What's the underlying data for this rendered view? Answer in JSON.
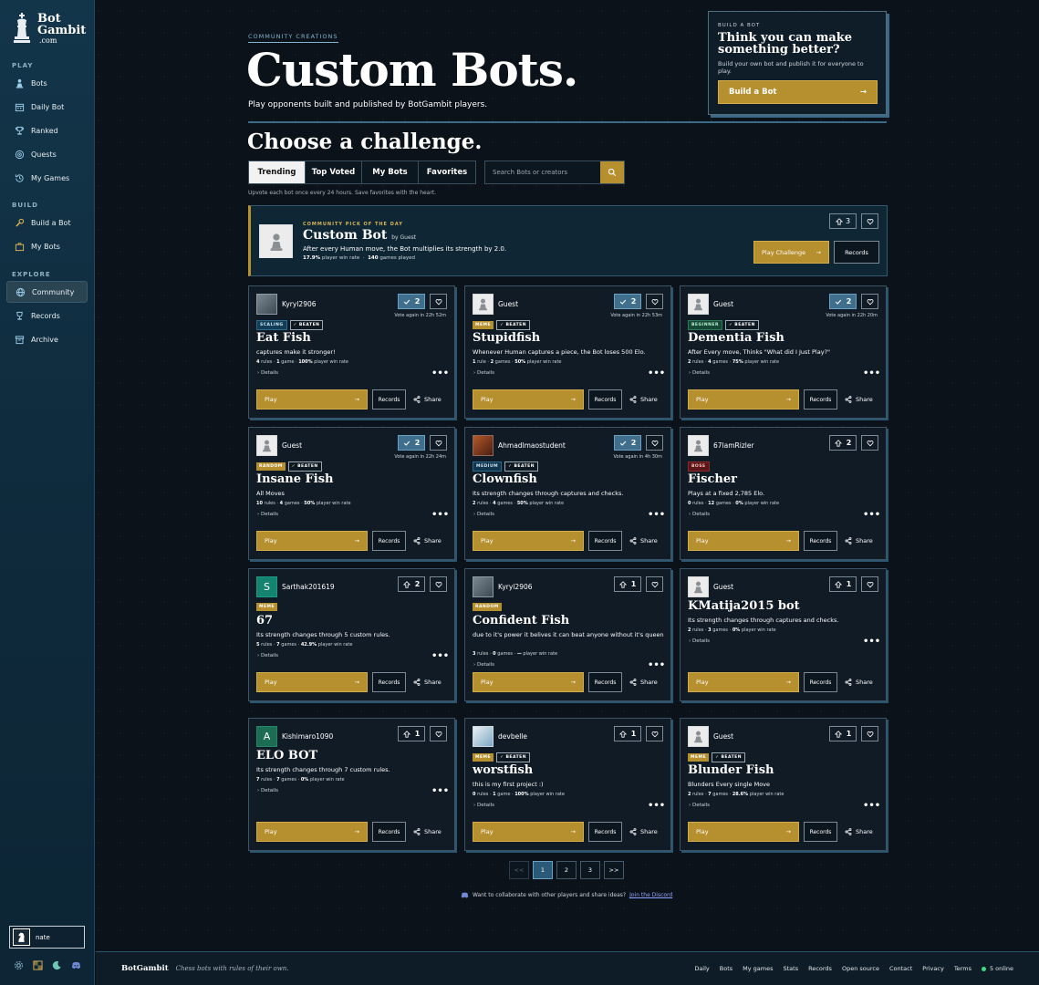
{
  "brand": {
    "line1": "Bot",
    "line2": "Gambit",
    "line3": ".com"
  },
  "sidebar": {
    "sections": [
      {
        "label": "PLAY",
        "items": [
          {
            "label": "Bots",
            "icon": "pawn-icon"
          },
          {
            "label": "Daily Bot",
            "icon": "calendar-icon"
          },
          {
            "label": "Ranked",
            "icon": "trophy-icon"
          },
          {
            "label": "Quests",
            "icon": "target-icon"
          },
          {
            "label": "My Games",
            "icon": "history-icon"
          }
        ]
      },
      {
        "label": "BUILD",
        "items": [
          {
            "label": "Build a Bot",
            "icon": "wrench-icon"
          },
          {
            "label": "My Bots",
            "icon": "briefcase-icon"
          }
        ]
      },
      {
        "label": "EXPLORE",
        "items": [
          {
            "label": "Community",
            "icon": "globe-icon"
          },
          {
            "label": "Records",
            "icon": "trophy-icon"
          },
          {
            "label": "Archive",
            "icon": "archive-icon"
          }
        ]
      }
    ],
    "user": {
      "name": "nate"
    }
  },
  "hero": {
    "eyebrow": "COMMUNITY CREATIONS",
    "title": "Custom Bots.",
    "subtitle": "Play opponents built and published by BotGambit players."
  },
  "build_card": {
    "eyebrow": "BUILD A BOT",
    "title": "Think you can make something better?",
    "text": "Build your own bot and publish it for everyone to play.",
    "button": "Build a Bot",
    "arrow": "→"
  },
  "challenge": {
    "title": "Choose a challenge.",
    "tabs": [
      "Trending",
      "Top Voted",
      "My Bots",
      "Favorites"
    ],
    "active_tab": "Trending",
    "search_placeholder": "Search Bots or creators",
    "hint": "Upvote each bot once every 24 hours. Save favorites with the heart."
  },
  "featured": {
    "eyebrow": "COMMUNITY PICK OF THE DAY",
    "name": "Custom Bot",
    "by": "by Guest",
    "desc": "After every Human move, the Bot multiplies its strength by 2.0.",
    "win_rate": "17.9%",
    "win_label": "player win rate",
    "games": "140",
    "games_label": "games played",
    "votes": "3",
    "play_label": "Play Challenge",
    "records_label": "Records",
    "arrow": "→"
  },
  "labels": {
    "play": "Play",
    "records": "Records",
    "share": "Share",
    "details": "Details",
    "rules": "rules",
    "games": "games",
    "game": "game",
    "rule": "rule",
    "win": "player win rate",
    "more": "•••",
    "arrow": "→",
    "beaten": "BEATEN"
  },
  "bots": [
    {
      "creator": "Kyryl2906",
      "avatar": "photo",
      "votes": "2",
      "voted": true,
      "again": "Vote again in 22h 52m",
      "tags": [
        "SCALING"
      ],
      "tagclass": [
        "scaling"
      ],
      "beaten": true,
      "title": "Eat Fish",
      "desc": "captures make it stronger!",
      "rules": "4",
      "rules_label": "rules",
      "games": "1",
      "games_label": "game",
      "win": "100%"
    },
    {
      "creator": "Guest",
      "avatar": "guest",
      "votes": "2",
      "voted": true,
      "again": "Vote again in 22h 53m",
      "tags": [
        "MEME"
      ],
      "tagclass": [
        "meme"
      ],
      "beaten": true,
      "title": "Stupidfish",
      "desc": "Whenever Human captures a piece, the Bot loses 500 Elo.",
      "rules": "1",
      "rules_label": "rule",
      "games": "2",
      "games_label": "games",
      "win": "50%"
    },
    {
      "creator": "Guest",
      "avatar": "guest",
      "votes": "2",
      "voted": true,
      "again": "Vote again in 22h 20m",
      "tags": [
        "BEGINNER"
      ],
      "tagclass": [
        "beginner"
      ],
      "beaten": true,
      "title": "Dementia Fish",
      "desc": "After Every move, Thinks \"What did I Just Play?\"",
      "rules": "2",
      "rules_label": "rules",
      "games": "4",
      "games_label": "games",
      "win": "75%"
    },
    {
      "creator": "Guest",
      "avatar": "guest",
      "votes": "2",
      "voted": true,
      "again": "Vote again in 22h 24m",
      "tags": [
        "RANDOM"
      ],
      "tagclass": [
        "random"
      ],
      "beaten": true,
      "title": "Insane Fish",
      "desc": "All Moves",
      "rules": "10",
      "rules_label": "rules",
      "games": "4",
      "games_label": "games",
      "win": "50%"
    },
    {
      "creator": "Ahmadlmaostudent",
      "avatar": "photo2",
      "votes": "2",
      "voted": true,
      "again": "Vote again in 4h 30m",
      "tags": [
        "MEDIUM"
      ],
      "tagclass": [
        "medium"
      ],
      "beaten": true,
      "title": "Clownfish",
      "desc": "Its strength changes through captures and checks.",
      "rules": "2",
      "rules_label": "rules",
      "games": "4",
      "games_label": "games",
      "win": "50%"
    },
    {
      "creator": "67lamRizler",
      "avatar": "guest",
      "votes": "2",
      "voted": false,
      "again": "",
      "tags": [
        "BOSS"
      ],
      "tagclass": [
        "boss"
      ],
      "beaten": false,
      "title": "Fischer",
      "desc": "Plays at a fixed 2,785 Elo.",
      "rules": "0",
      "rules_label": "rules",
      "games": "12",
      "games_label": "games",
      "win": "0%"
    },
    {
      "creator": "Sarthak201619",
      "avatar": "teal",
      "initial": "S",
      "votes": "2",
      "voted": false,
      "again": "",
      "tags": [
        "MEME"
      ],
      "tagclass": [
        "meme"
      ],
      "beaten": false,
      "title": "67",
      "desc": "Its strength changes through 5 custom rules.",
      "rules": "5",
      "rules_label": "rules",
      "games": "7",
      "games_label": "games",
      "win": "42.9%"
    },
    {
      "creator": "Kyryl2906",
      "avatar": "photo",
      "votes": "1",
      "voted": false,
      "again": "",
      "tags": [
        "RANDOM"
      ],
      "tagclass": [
        "random"
      ],
      "beaten": false,
      "title": "Confident Fish",
      "desc": "due to it's power it belives it can beat anyone without it's queen",
      "rules": "3",
      "rules_label": "rules",
      "games": "0",
      "games_label": "games",
      "win": "—"
    },
    {
      "creator": "Guest",
      "avatar": "guest",
      "votes": "1",
      "voted": false,
      "again": "",
      "tags": [],
      "tagclass": [],
      "beaten": false,
      "title": "KMatija2015 bot",
      "desc": "Its strength changes through captures and checks.",
      "rules": "2",
      "rules_label": "rules",
      "games": "3",
      "games_label": "games",
      "win": "0%"
    },
    {
      "creator": "Kishimaro1090",
      "avatar": "green",
      "initial": "A",
      "votes": "1",
      "voted": false,
      "again": "",
      "tags": [],
      "tagclass": [],
      "beaten": false,
      "title": "ELO BOT",
      "desc": "Its strength changes through 7 custom rules.",
      "rules": "7",
      "rules_label": "rules",
      "games": "7",
      "games_label": "games",
      "win": "0%"
    },
    {
      "creator": "devbelle",
      "avatar": "photo3",
      "votes": "1",
      "voted": false,
      "again": "",
      "tags": [
        "MEME"
      ],
      "tagclass": [
        "meme"
      ],
      "beaten": true,
      "title": "worstfish",
      "desc": "this is my first project :)",
      "rules": "0",
      "rules_label": "rules",
      "games": "1",
      "games_label": "game",
      "win": "100%"
    },
    {
      "creator": "Guest",
      "avatar": "guest",
      "votes": "1",
      "voted": false,
      "again": "",
      "tags": [
        "MEME"
      ],
      "tagclass": [
        "meme"
      ],
      "beaten": true,
      "title": "Blunder Fish",
      "desc": "Blunders Every single Move",
      "rules": "2",
      "rules_label": "rules",
      "games": "7",
      "games_label": "games",
      "win": "28.6%"
    }
  ],
  "pager": {
    "prev": "<<",
    "pages": [
      "1",
      "2",
      "3"
    ],
    "active": "1",
    "next": ">>"
  },
  "discord": {
    "text": "Want to collaborate with other players and share ideas?",
    "link": "Join the Discord"
  },
  "footer": {
    "brand": "BotGambit",
    "tagline": "Chess bots with rules of their own.",
    "links": [
      "Daily",
      "Bots",
      "My games",
      "Stats",
      "Records",
      "Open source",
      "Contact",
      "Privacy",
      "Terms"
    ],
    "online": "5 online"
  },
  "colors": {
    "accent": "#b68f2e",
    "voted": "#3f6f8c",
    "sidebar": "#13354a",
    "online": "#3ddc84"
  }
}
